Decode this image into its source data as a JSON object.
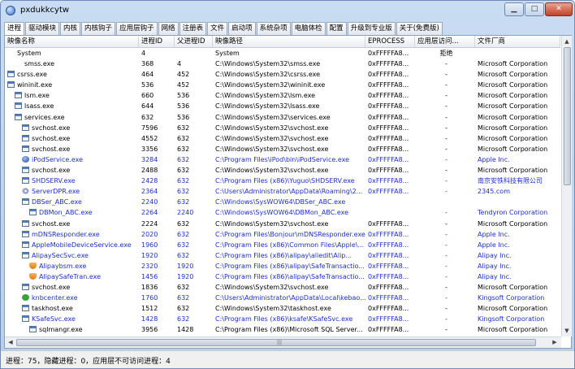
{
  "window": {
    "title": "pxdukkcytw",
    "controls": {
      "minimize": "▁",
      "maximize": "□",
      "close": "✕"
    }
  },
  "tabs": [
    "进程",
    "驱动模块",
    "内核",
    "内核钩子",
    "应用层钩子",
    "网络",
    "注册表",
    "文件",
    "启动项",
    "系统杂项",
    "电脑体检",
    "配置",
    "升级到专业版",
    "关于(免费版)"
  ],
  "columns": [
    "映像名称",
    "进程ID",
    "父进程ID",
    "映像路径",
    "EPROCESS",
    "应用层访问...",
    "文件厂商"
  ],
  "rows": [
    {
      "name": "System",
      "pid": "4",
      "ppid": "",
      "path": "System",
      "eprocess": "0xFFFFFA8...",
      "access": "拒绝",
      "vendor": "",
      "blue": false,
      "indent": 0,
      "icon": "blank"
    },
    {
      "name": "smss.exe",
      "pid": "368",
      "ppid": "4",
      "path": "C:\\Windows\\System32\\smss.exe",
      "eprocess": "0xFFFFFA8...",
      "access": "-",
      "vendor": "Microsoft Corporation",
      "blue": false,
      "indent": 1,
      "icon": "blank"
    },
    {
      "name": "csrss.exe",
      "pid": "464",
      "ppid": "452",
      "path": "C:\\Windows\\System32\\csrss.exe",
      "eprocess": "0xFFFFFA8...",
      "access": "-",
      "vendor": "Microsoft Corporation",
      "blue": false,
      "indent": 0,
      "icon": "window"
    },
    {
      "name": "wininit.exe",
      "pid": "536",
      "ppid": "452",
      "path": "C:\\Windows\\System32\\wininit.exe",
      "eprocess": "0xFFFFFA8...",
      "access": "-",
      "vendor": "Microsoft Corporation",
      "blue": false,
      "indent": 0,
      "icon": "window"
    },
    {
      "name": "lsm.exe",
      "pid": "660",
      "ppid": "536",
      "path": "C:\\Windows\\System32\\lsm.exe",
      "eprocess": "0xFFFFFA8...",
      "access": "-",
      "vendor": "Microsoft Corporation",
      "blue": false,
      "indent": 1,
      "icon": "window"
    },
    {
      "name": "lsass.exe",
      "pid": "644",
      "ppid": "536",
      "path": "C:\\Windows\\System32\\lsass.exe",
      "eprocess": "0xFFFFFA8...",
      "access": "-",
      "vendor": "Microsoft Corporation",
      "blue": false,
      "indent": 1,
      "icon": "window"
    },
    {
      "name": "services.exe",
      "pid": "632",
      "ppid": "536",
      "path": "C:\\Windows\\System32\\services.exe",
      "eprocess": "0xFFFFFA8...",
      "access": "-",
      "vendor": "Microsoft Corporation",
      "blue": false,
      "indent": 1,
      "icon": "window"
    },
    {
      "name": "svchost.exe",
      "pid": "7596",
      "ppid": "632",
      "path": "C:\\Windows\\System32\\svchost.exe",
      "eprocess": "0xFFFFFA8...",
      "access": "-",
      "vendor": "Microsoft Corporation",
      "blue": false,
      "indent": 2,
      "icon": "window"
    },
    {
      "name": "svchost.exe",
      "pid": "4552",
      "ppid": "632",
      "path": "C:\\Windows\\System32\\svchost.exe",
      "eprocess": "0xFFFFFA8...",
      "access": "-",
      "vendor": "Microsoft Corporation",
      "blue": false,
      "indent": 2,
      "icon": "window"
    },
    {
      "name": "svchost.exe",
      "pid": "3356",
      "ppid": "632",
      "path": "C:\\Windows\\System32\\svchost.exe",
      "eprocess": "0xFFFFFA8...",
      "access": "-",
      "vendor": "Microsoft Corporation",
      "blue": false,
      "indent": 2,
      "icon": "window"
    },
    {
      "name": "iPodService.exe",
      "pid": "3284",
      "ppid": "632",
      "path": "C:\\Program Files\\iPod\\bin\\iPodService.exe",
      "eprocess": "0xFFFFFA8...",
      "access": "-",
      "vendor": "Apple Inc.",
      "blue": true,
      "indent": 2,
      "icon": "apple"
    },
    {
      "name": "svchost.exe",
      "pid": "2488",
      "ppid": "632",
      "path": "C:\\Windows\\System32\\svchost.exe",
      "eprocess": "0xFFFFFA8...",
      "access": "-",
      "vendor": "Microsoft Corporation",
      "blue": false,
      "indent": 2,
      "icon": "window"
    },
    {
      "name": "SHDSERV.exe",
      "pid": "2428",
      "ppid": "632",
      "path": "C:\\Program Files (x86)\\Yuguo\\SHDSERV.exe",
      "eprocess": "0xFFFFFA8...",
      "access": "-",
      "vendor": "南京安铁科技有限公司",
      "blue": true,
      "indent": 2,
      "icon": "window"
    },
    {
      "name": "ServerDPR.exe",
      "pid": "2364",
      "ppid": "632",
      "path": "C:\\Users\\Administrator\\AppData\\Roaming\\2...",
      "eprocess": "0xFFFFFA8...",
      "access": "-",
      "vendor": "2345.com",
      "blue": true,
      "indent": 2,
      "icon": "disc"
    },
    {
      "name": "DBSer_ABC.exe",
      "pid": "2240",
      "ppid": "632",
      "path": "C:\\Windows\\SysWOW64\\DBSer_ABC.exe",
      "eprocess": "",
      "access": "",
      "vendor": "",
      "blue": true,
      "indent": 2,
      "icon": "window"
    },
    {
      "name": "DBMon_ABC.exe",
      "pid": "2264",
      "ppid": "2240",
      "path": "C:\\Windows\\SysWOW64\\DBMon_ABC.exe",
      "eprocess": "",
      "access": "-",
      "vendor": "Tendyron Corporation",
      "blue": true,
      "indent": 3,
      "icon": "window"
    },
    {
      "name": "svchost.exe",
      "pid": "2224",
      "ppid": "632",
      "path": "C:\\Windows\\System32\\svchost.exe",
      "eprocess": "0xFFFFFA8...",
      "access": "-",
      "vendor": "Microsoft Corporation",
      "blue": false,
      "indent": 2,
      "icon": "window"
    },
    {
      "name": "mDNSResponder.exe",
      "pid": "2020",
      "ppid": "632",
      "path": "C:\\Program Files\\Bonjour\\mDNSResponder.exe",
      "eprocess": "0xFFFFFA8...",
      "access": "-",
      "vendor": "Apple Inc.",
      "blue": true,
      "indent": 2,
      "icon": "window"
    },
    {
      "name": "AppleMobileDeviceService.exe",
      "pid": "1960",
      "ppid": "632",
      "path": "C:\\Program Files (x86)\\Common Files\\Apple\\...",
      "eprocess": "0xFFFFFA8...",
      "access": "-",
      "vendor": "Apple Inc.",
      "blue": true,
      "indent": 2,
      "icon": "window"
    },
    {
      "name": "AlipaySecSvc.exe",
      "pid": "1920",
      "ppid": "632",
      "path": "C:\\Program Files (x86)\\alipay\\aliedit\\Alip...",
      "eprocess": "0xFFFFFA8...",
      "access": "-",
      "vendor": "Alipay Inc.",
      "blue": true,
      "indent": 2,
      "icon": "window"
    },
    {
      "name": "Alipaybsm.exe",
      "pid": "2320",
      "ppid": "1920",
      "path": "C:\\Program Files (x86)\\alipay\\SafeTransactio...",
      "eprocess": "0xFFFFFA8...",
      "access": "-",
      "vendor": "Alipay Inc.",
      "blue": true,
      "indent": 3,
      "icon": "shield"
    },
    {
      "name": "AlipaySafeTran.exe",
      "pid": "1456",
      "ppid": "1920",
      "path": "C:\\Program Files (x86)\\alipay\\SafeTransactio...",
      "eprocess": "0xFFFFFA8...",
      "access": "-",
      "vendor": "Alipay Inc.",
      "blue": true,
      "indent": 3,
      "icon": "shield"
    },
    {
      "name": "svchost.exe",
      "pid": "1836",
      "ppid": "632",
      "path": "C:\\Windows\\System32\\svchost.exe",
      "eprocess": "0xFFFFFA8...",
      "access": "-",
      "vendor": "Microsoft Corporation",
      "blue": false,
      "indent": 2,
      "icon": "window"
    },
    {
      "name": "knbcenter.exe",
      "pid": "1760",
      "ppid": "632",
      "path": "C:\\Users\\Administrator\\AppData\\Local\\kebao...",
      "eprocess": "0xFFFFFA8...",
      "access": "-",
      "vendor": "Kingsoft Corporation",
      "blue": true,
      "indent": 2,
      "icon": "check"
    },
    {
      "name": "taskhost.exe",
      "pid": "1512",
      "ppid": "632",
      "path": "C:\\Windows\\System32\\taskhost.exe",
      "eprocess": "0xFFFFFA8...",
      "access": "-",
      "vendor": "Microsoft Corporation",
      "blue": false,
      "indent": 2,
      "icon": "window"
    },
    {
      "name": "KSafeSvc.exe",
      "pid": "1428",
      "ppid": "632",
      "path": "C:\\Program Files (x86)\\ksafe\\KSafeSvc.exe",
      "eprocess": "0xFFFFFA8...",
      "access": "-",
      "vendor": "Kingsoft Corporation",
      "blue": true,
      "indent": 2,
      "icon": "window"
    },
    {
      "name": "sqlmangr.exe",
      "pid": "3956",
      "ppid": "1428",
      "path": "C:\\Program Files (x86)\\Microsoft SQL Server...",
      "eprocess": "0xFFFFFA8...",
      "access": "-",
      "vendor": "Microsoft Corporation",
      "blue": false,
      "indent": 3,
      "icon": "window"
    }
  ],
  "status": "进程：75，隐藏进程：0，应用层不可访问进程：4"
}
